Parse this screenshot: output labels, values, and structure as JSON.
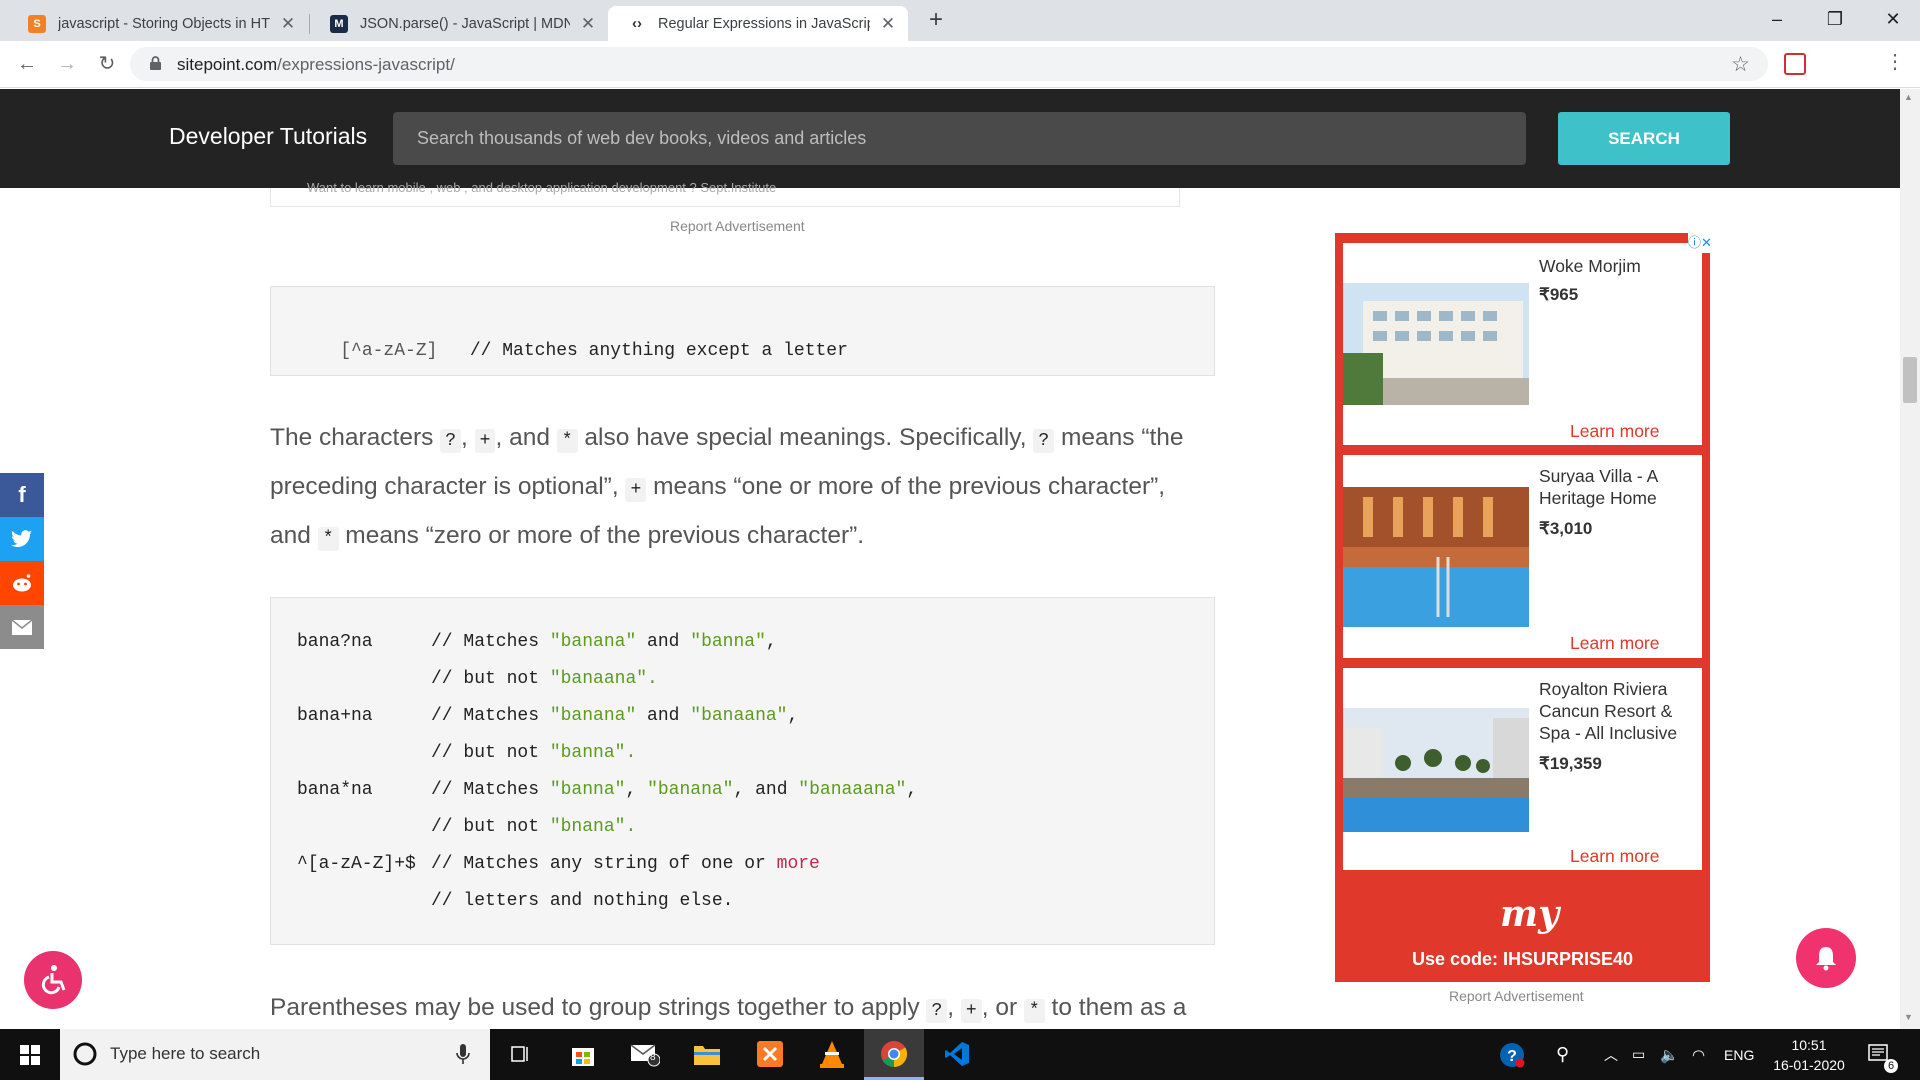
{
  "browser": {
    "tabs": [
      {
        "title": "javascript - Storing Objects in HT",
        "active": false
      },
      {
        "title": "JSON.parse() - JavaScript | MDN",
        "active": false
      },
      {
        "title": "Regular Expressions in JavaScript",
        "active": true
      }
    ],
    "url_domain": "sitepoint.com",
    "url_path": "/expressions-javascript/"
  },
  "site": {
    "brand": "Developer Tutorials",
    "search_placeholder": "Search thousands of web dev books, videos and articles",
    "search_button": "SEARCH"
  },
  "article": {
    "ad_top_text": "Want to learn mobile , web , and desktop application development ? Sept.Institute",
    "report_ad": "Report Advertisement",
    "code1": {
      "pattern": "[^a-zA-Z]",
      "comment": "// Matches anything except a letter"
    },
    "para1": {
      "t1": "The characters ",
      "c1": "?",
      "t2": ", ",
      "c2": "+",
      "t3": ", and ",
      "c3": "*",
      "t4": " also have special meanings. Specifically, ",
      "c4": "?",
      "t5": " means “the preceding character is optional”, ",
      "c5": "+",
      "t6": " means “one or more of the previous character”, and ",
      "c6": "*",
      "t7": " means “zero or more of the previous character”."
    },
    "code2": [
      {
        "pattern": "bana?na",
        "pre": "// Matches ",
        "s1": "\"banana\"",
        "mid": " and ",
        "s2": "\"banna\"",
        "post": ","
      },
      {
        "pattern": "",
        "pre": "// but not ",
        "s1": "\"banaana\"",
        "post": "."
      },
      {
        "pattern": "bana+na",
        "pre": "// Matches ",
        "s1": "\"banana\"",
        "mid": " and ",
        "s2": "\"banaana\"",
        "post": ","
      },
      {
        "pattern": "",
        "pre": "// but not ",
        "s1": "\"banna\"",
        "post": "."
      },
      {
        "pattern": "bana*na",
        "pre": "// Matches ",
        "s1": "\"banna\"",
        "mid": ", ",
        "s2": "\"banana\"",
        "mid2": ", and ",
        "s3": "\"banaaana\"",
        "post": ","
      },
      {
        "pattern": "",
        "pre": "// but not ",
        "s1": "\"bnana\"",
        "post": "."
      },
      {
        "pattern": "^[a-zA-Z]+$",
        "pre": "// Matches any string of one or ",
        "kw": "more"
      },
      {
        "pattern": "",
        "pre": "// letters and nothing else."
      }
    ],
    "para2": {
      "t1": "Parentheses may be used to group strings together to apply ",
      "c1": "?",
      "t2": ", ",
      "c2": "+",
      "t3": ", or ",
      "c3": "*",
      "t4": " to them as a"
    }
  },
  "ad": {
    "cards": [
      {
        "name": "Woke Morjim",
        "price": "₹965",
        "cta": "Learn more"
      },
      {
        "name": "Suryaa Villa - A Heritage Home",
        "price": "₹3,010",
        "cta": "Learn more"
      },
      {
        "name": "Royalton Riviera Cancun Resort & Spa - All Inclusive",
        "price": "₹19,359",
        "cta": "Learn more"
      }
    ],
    "logo": "my",
    "promo": "Use code: IHSURPRISE40",
    "report": "Report Advertisement",
    "colors": {
      "brand_red": "#e0392b"
    }
  },
  "taskbar": {
    "search_placeholder": "Type here to search",
    "mail_badge": "8",
    "lang": "ENG",
    "time": "10:51",
    "date": "16-01-2020",
    "notif_count": "6"
  }
}
